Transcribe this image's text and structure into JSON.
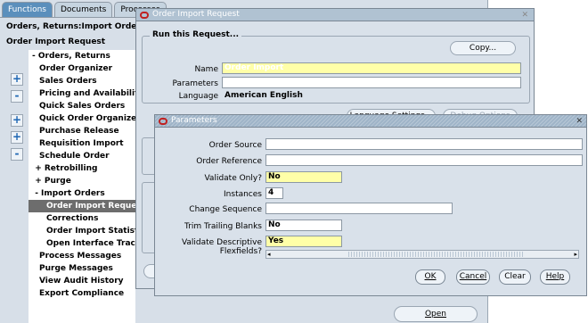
{
  "navigator": {
    "tabs": [
      "Functions",
      "Documents",
      "Processes"
    ],
    "breadcrumb": "Orders, Returns:Import Orders:Orde",
    "title": "Order Import Request",
    "side_buttons": [
      "+",
      "-",
      "+",
      "+",
      "-"
    ],
    "tree": [
      "- Orders, Returns",
      "Order Organizer",
      "Sales Orders",
      "Pricing and Availability",
      "Quick Sales Orders",
      "Quick Order Organizer",
      "Purchase Release",
      "Requisition Import",
      "Schedule Order",
      "+ Retrobilling",
      "+ Purge",
      "- Import Orders",
      "Order Import Request",
      "Corrections",
      "Order Import Statistics",
      "Open Interface Tracking",
      "Process Messages",
      "Purge Messages",
      "View Audit History",
      "Export Compliance"
    ],
    "selected_index": 12,
    "open_button": "Open"
  },
  "request_window": {
    "title": "Order Import Request",
    "group_label": "Run this Request...",
    "copy_button": "Copy...",
    "labels": {
      "name": "Name",
      "parameters": "Parameters",
      "language": "Language"
    },
    "values": {
      "name": "Order Import",
      "parameters": "",
      "language": "American English"
    },
    "language_settings_button": "Language Settings...",
    "debug_options_button": "Debug Options"
  },
  "parameters_window": {
    "title": "Parameters",
    "fields": [
      {
        "label": "Order Source",
        "value": ""
      },
      {
        "label": "Order Reference",
        "value": ""
      },
      {
        "label": "Validate Only?",
        "value": "No"
      },
      {
        "label": "Instances",
        "value": "4"
      },
      {
        "label": "Change Sequence",
        "value": ""
      },
      {
        "label": "Trim Trailing Blanks",
        "value": "No"
      },
      {
        "label": "Validate Descriptive Flexfields?",
        "value": "Yes"
      }
    ],
    "buttons": {
      "ok": "OK",
      "cancel": "Cancel",
      "clear": "Clear",
      "help": "Help"
    }
  }
}
